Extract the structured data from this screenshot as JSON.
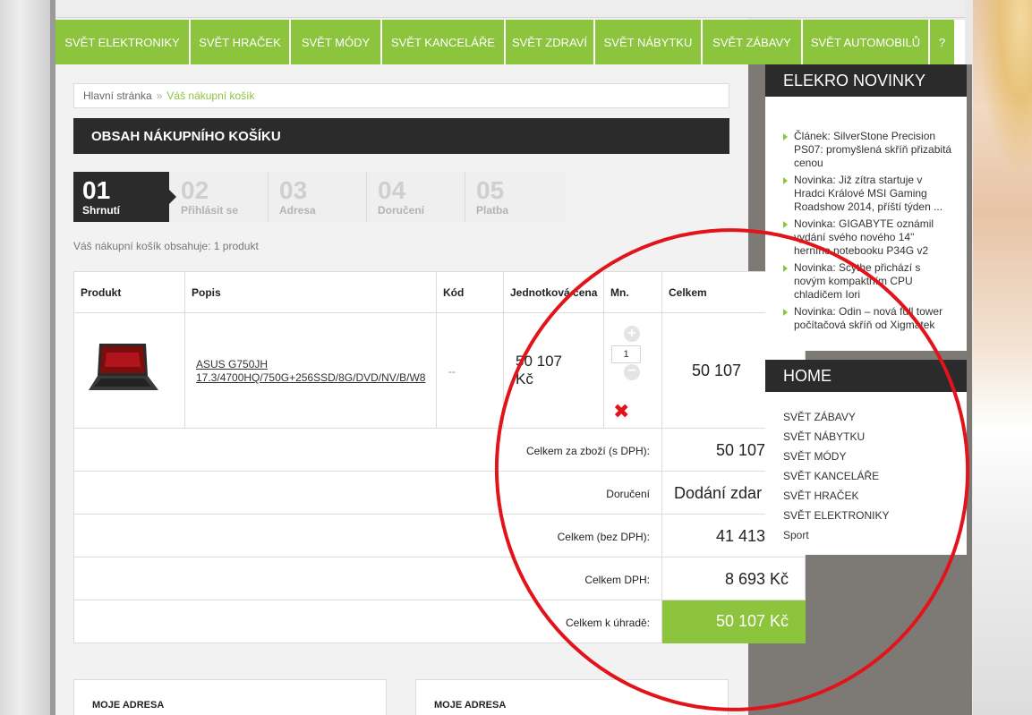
{
  "nav": {
    "items": [
      "SVĚT ELEKTRONIKY",
      "SVĚT HRAČEK",
      "SVĚT MÓDY",
      "SVĚT KANCELÁŘE",
      "SVĚT ZDRAVÍ",
      "SVĚT NÁBYTKU",
      "SVĚT ZÁBAVY",
      "SVĚT AUTOMOBILŮ",
      "?"
    ]
  },
  "breadcrumb": {
    "home": "Hlavní stránka",
    "separator": "»",
    "current": "Váš nákupní košík"
  },
  "cart": {
    "title": "OBSAH NÁKUPNÍHO KOŠÍKU",
    "summary": "Váš nákupní košík obsahuje: 1 produkt",
    "steps": [
      {
        "num": "01",
        "label": "Shrnutí",
        "active": true
      },
      {
        "num": "02",
        "label": "Přihlásit se",
        "active": false
      },
      {
        "num": "03",
        "label": "Adresa",
        "active": false
      },
      {
        "num": "04",
        "label": "Doručení",
        "active": false
      },
      {
        "num": "05",
        "label": "Platba",
        "active": false
      }
    ],
    "columns": [
      "Produkt",
      "Popis",
      "Kód",
      "Jednotková cena",
      "Mn.",
      "Celkem"
    ],
    "item": {
      "description_line1": "ASUS G750JH",
      "description_line2": "17.3/4700HQ/750G+256SSD/8G/DVD/NV/B/W8",
      "code": "--",
      "unit_price_line1": "50 107",
      "unit_price_line2": "Kč",
      "quantity": "1",
      "total": "50 107"
    },
    "totals": {
      "goods_label": "Celkem za zboží (s DPH):",
      "goods_value": "50 107",
      "delivery_label": "Doručení",
      "delivery_value": "Dodání zdar",
      "net_label": "Celkem (bez DPH):",
      "net_value": "41 413",
      "vat_label": "Celkem DPH:",
      "vat_value": "8 693 Kč",
      "grand_label": "Celkem k úhradě:",
      "grand_value": "50 107 Kč"
    },
    "addresses": [
      "MOJE ADRESA",
      "MOJE ADRESA"
    ]
  },
  "sidebar": {
    "news_title": "ELEKRO NOVINKY",
    "news": [
      "Článek: SilverStone Precision PS07: promyšlená skříň přizabitá cenou",
      "Novinka: Již zítra startuje v Hradci Králové MSI Gaming Roadshow 2014, příští týden ...",
      "Novinka: GIGABYTE oznámil vydání svého nového 14\" herního notebooku P34G v2",
      "Novinka: Scythe přichází s novým kompaktním CPU chladičem Iori",
      "Novinka: Odin – nová full tower počítačová skříň od Xigmatek"
    ],
    "home_title": "HOME",
    "home_links": [
      "SVĚT ZÁBAVY",
      "SVĚT NÁBYTKU",
      "SVĚT MÓDY",
      "SVĚT KANCELÁŘE",
      "SVĚT HRAČEK",
      "SVĚT ELEKTRONIKY",
      "Sport"
    ]
  },
  "colors": {
    "accent": "#8cc43e",
    "dark": "#2b2b2b",
    "annotation": "#e2141b"
  }
}
